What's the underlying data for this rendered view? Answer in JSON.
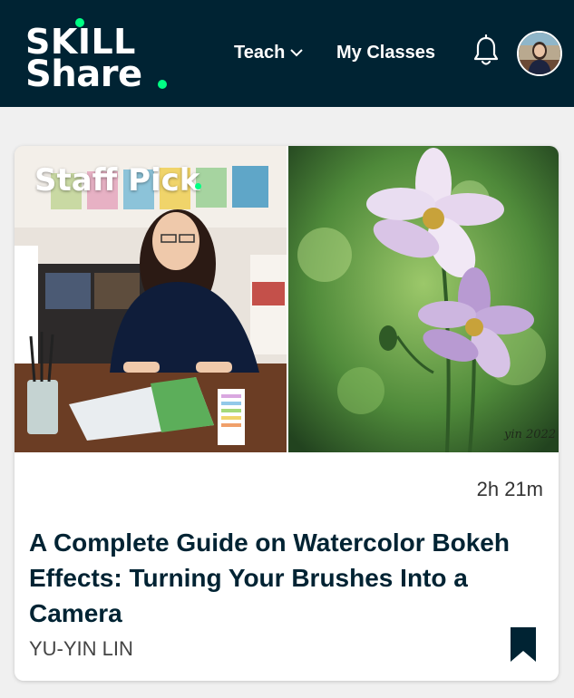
{
  "colors": {
    "header_bg": "#002333",
    "accent_green": "#00ff84",
    "text_dark": "#002333"
  },
  "header": {
    "logo_line1": "SKILL",
    "logo_line2": "Share",
    "nav_teach": "Teach",
    "nav_my_classes": "My Classes",
    "bell_icon": "bell-icon",
    "avatar_icon": "user-avatar"
  },
  "card": {
    "badge": "Staff Pick",
    "duration": "2h 21m",
    "title": "A Complete Guide on Watercolor Bokeh Effects: Turning Your Brushes Into a Camera",
    "author": "YU-YIN LIN",
    "bookmark_icon": "bookmark-icon",
    "signature": "yin 2022"
  }
}
